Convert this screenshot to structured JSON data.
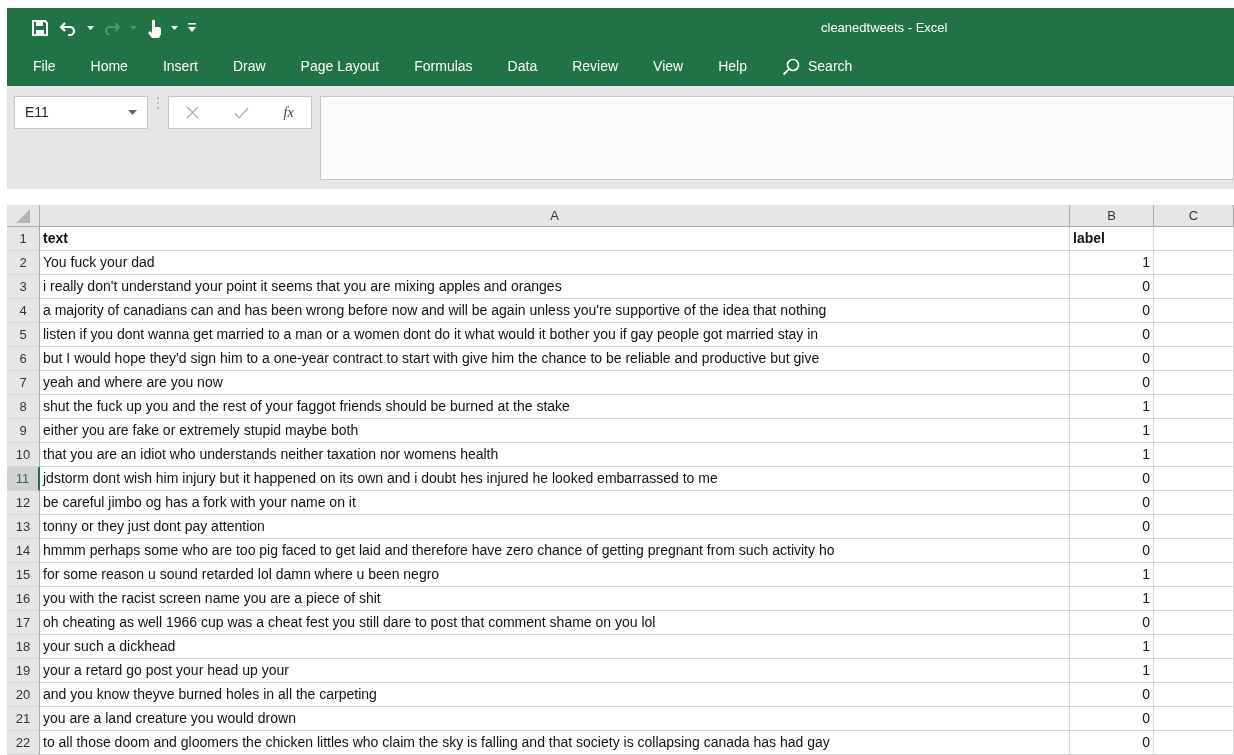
{
  "window": {
    "title": "cleanedtweets  -  Excel"
  },
  "quick_access": {
    "redo_disabled": true
  },
  "ribbon_tabs": [
    {
      "label": "File"
    },
    {
      "label": "Home"
    },
    {
      "label": "Insert"
    },
    {
      "label": "Draw"
    },
    {
      "label": "Page Layout"
    },
    {
      "label": "Formulas"
    },
    {
      "label": "Data"
    },
    {
      "label": "Review"
    },
    {
      "label": "View"
    },
    {
      "label": "Help"
    }
  ],
  "search": {
    "label": "Search"
  },
  "formula_bar": {
    "name_box": "E11",
    "function_label": "fx"
  },
  "columns": [
    "A",
    "B",
    "C"
  ],
  "rows": [
    {
      "number": "1",
      "text": "text",
      "label": "label",
      "kind": "header",
      "selected": false
    },
    {
      "number": "2",
      "text": "You fuck your dad",
      "label": "1",
      "kind": "data",
      "selected": false
    },
    {
      "number": "3",
      "text": "i really don't understand your point it seems that you are mixing apples and oranges",
      "label": "0",
      "kind": "data",
      "selected": false
    },
    {
      "number": "4",
      "text": "a majority of canadians can and has been wrong before now and will be again  unless you're supportive of the idea that nothing",
      "label": "0",
      "kind": "data",
      "selected": false
    },
    {
      "number": "5",
      "text": "listen if you dont wanna get married to a man or a women dont do it  what would it bother you if gay people got married stay in",
      "label": "0",
      "kind": "data",
      "selected": false
    },
    {
      "number": "6",
      "text": "but I would hope they'd sign him to a one-year contract to start with give him the chance to be reliable and productive but give",
      "label": "0",
      "kind": "data",
      "selected": false
    },
    {
      "number": "7",
      "text": "yeah and where are you now",
      "label": "0",
      "kind": "data",
      "selected": false
    },
    {
      "number": "8",
      "text": "shut the fuck up you and the rest of your faggot friends should be burned at the stake",
      "label": "1",
      "kind": "data",
      "selected": false
    },
    {
      "number": "9",
      "text": "either you are fake or extremely stupid maybe both",
      "label": "1",
      "kind": "data",
      "selected": false
    },
    {
      "number": "10",
      "text": "that you are an idiot who understands neither taxation nor womens health",
      "label": "1",
      "kind": "data",
      "selected": false
    },
    {
      "number": "11",
      "text": "jdstorm dont wish him injury but it happened on its own and i doubt hes injured he looked embarrassed to me",
      "label": "0",
      "kind": "data",
      "selected": true
    },
    {
      "number": "12",
      "text": "be careful jimbo og has a fork with your name on it",
      "label": "0",
      "kind": "data",
      "selected": false
    },
    {
      "number": "13",
      "text": "tonny  or they just dont pay attention",
      "label": "0",
      "kind": "data",
      "selected": false
    },
    {
      "number": "14",
      "text": "hmmm perhaps some who are too pig faced to get laid and therefore have zero chance of getting pregnant from such activity ho",
      "label": "0",
      "kind": "data",
      "selected": false
    },
    {
      "number": "15",
      "text": "for some reason u sound retarded lol damn where u been negro",
      "label": "1",
      "kind": "data",
      "selected": false
    },
    {
      "number": "16",
      "text": "you with the racist screen name you are a piece of shit",
      "label": "1",
      "kind": "data",
      "selected": false
    },
    {
      "number": "17",
      "text": "oh cheating as well 1966 cup was a cheat fest you still dare to post that comment shame on you lol",
      "label": "0",
      "kind": "data",
      "selected": false
    },
    {
      "number": "18",
      "text": "your such a dickhead",
      "label": "1",
      "kind": "data",
      "selected": false
    },
    {
      "number": "19",
      "text": "your a retard go post your head up your",
      "label": "1",
      "kind": "data",
      "selected": false
    },
    {
      "number": "20",
      "text": "and you know theyve burned holes in all the carpeting",
      "label": "0",
      "kind": "data",
      "selected": false
    },
    {
      "number": "21",
      "text": "you are a land creature you would drown",
      "label": "0",
      "kind": "data",
      "selected": false
    },
    {
      "number": "22",
      "text": "to all those doom and gloomers the chicken littles who claim the sky is falling and that society is collapsing canada has had gay",
      "label": "0",
      "kind": "data",
      "selected": false
    }
  ]
}
